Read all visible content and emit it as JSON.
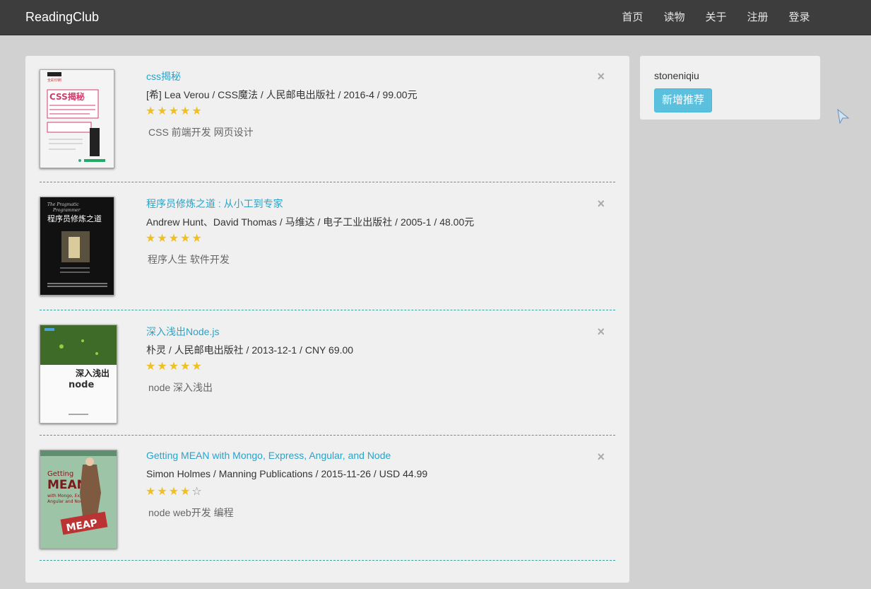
{
  "navbar": {
    "brand": "ReadingClub",
    "links": [
      "首页",
      "读物",
      "关于",
      "注册",
      "登录"
    ]
  },
  "books": [
    {
      "title": "css揭秘",
      "meta": "[希] Lea Verou / CSS魔法 / 人民邮电出版社 / 2016-4 / 99.00元",
      "rating": 5,
      "tags": "CSS 前端开发 网页设计",
      "cover_text": "CSS揭秘"
    },
    {
      "title": "程序员修炼之道 : 从小工到专家",
      "meta": "Andrew Hunt、David Thomas / 马维达 / 电子工业出版社 / 2005-1 / 48.00元",
      "rating": 5,
      "tags": "程序人生 软件开发",
      "cover_text": "程序员修炼之道"
    },
    {
      "title": "深入浅出Node.js",
      "meta": "朴灵 / 人民邮电出版社 / 2013-12-1 / CNY 69.00",
      "rating": 5,
      "tags": "node 深入浅出",
      "cover_text": "深入浅出"
    },
    {
      "title": "Getting MEAN with Mongo, Express, Angular, and Node",
      "meta": "Simon Holmes / Manning Publications / 2015-11-26 / USD 44.99",
      "rating": 4,
      "tags": "node web开发 编程",
      "cover_text": "Getting MEAN"
    }
  ],
  "close_symbol": "×",
  "sidebar": {
    "username": "stoneniqiu",
    "add_button": "新增推荐"
  },
  "colors": {
    "navbar": "#3d3d3d",
    "link": "#2aa3c7",
    "star": "#f0c020",
    "button": "#5bc0de"
  }
}
